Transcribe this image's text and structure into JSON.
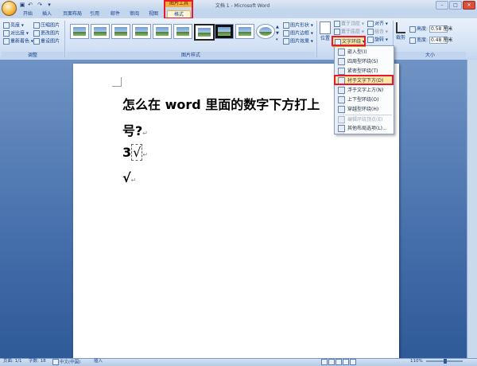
{
  "window": {
    "title": "文档 1 - Microsoft Word",
    "context_tool": "图片工具"
  },
  "tabs": [
    "开始",
    "插入",
    "页面布局",
    "引用",
    "邮件",
    "审阅",
    "视图",
    "格式"
  ],
  "ribbon": {
    "adjust": {
      "label": "调整",
      "brightness": "亮度",
      "contrast": "对比度",
      "recolor": "重新着色",
      "compress": "压缩图片",
      "change_pic": "更改图片",
      "reset_pic": "重设图片"
    },
    "styles": {
      "label": "图片样式",
      "shape": "图片形状",
      "border": "图片边框",
      "effects": "图片效果"
    },
    "arrange": {
      "position": "位置",
      "bring_front": "置于顶层",
      "send_back": "置于底层",
      "text_wrap": "文字环绕",
      "align": "对齐",
      "group": "组合",
      "rotate": "旋转"
    },
    "size": {
      "label": "大小",
      "crop": "裁剪",
      "height_label": "高度:",
      "height_value": "0.58 厘米",
      "width_label": "宽度:",
      "width_value": "0.48 厘米"
    }
  },
  "menu": {
    "items": [
      {
        "label": "嵌入型(I)",
        "disabled": false
      },
      {
        "label": "四周型环绕(S)",
        "disabled": false
      },
      {
        "label": "紧密型环绕(T)",
        "disabled": false
      },
      {
        "label": "衬于文字下方(D)",
        "disabled": false,
        "selected": true
      },
      {
        "label": "浮于文字上方(N)",
        "disabled": false
      },
      {
        "label": "上下型环绕(O)",
        "disabled": false
      },
      {
        "label": "穿越型环绕(H)",
        "disabled": false
      },
      {
        "label": "编辑环绕顶点(E)",
        "disabled": true
      },
      {
        "label": "其他布局选项(L)...",
        "disabled": false
      }
    ]
  },
  "document": {
    "line1": "怎么在 word 里面的数字下方打上",
    "line2": "号?",
    "line3_num": "3",
    "line3_check": "√",
    "line4": "√",
    "para_mark": "↵"
  },
  "status": {
    "page": "页面: 1/1",
    "words": "字数: 18",
    "lang": "中文(中国)",
    "insert": "插入",
    "zoom": "110%"
  }
}
